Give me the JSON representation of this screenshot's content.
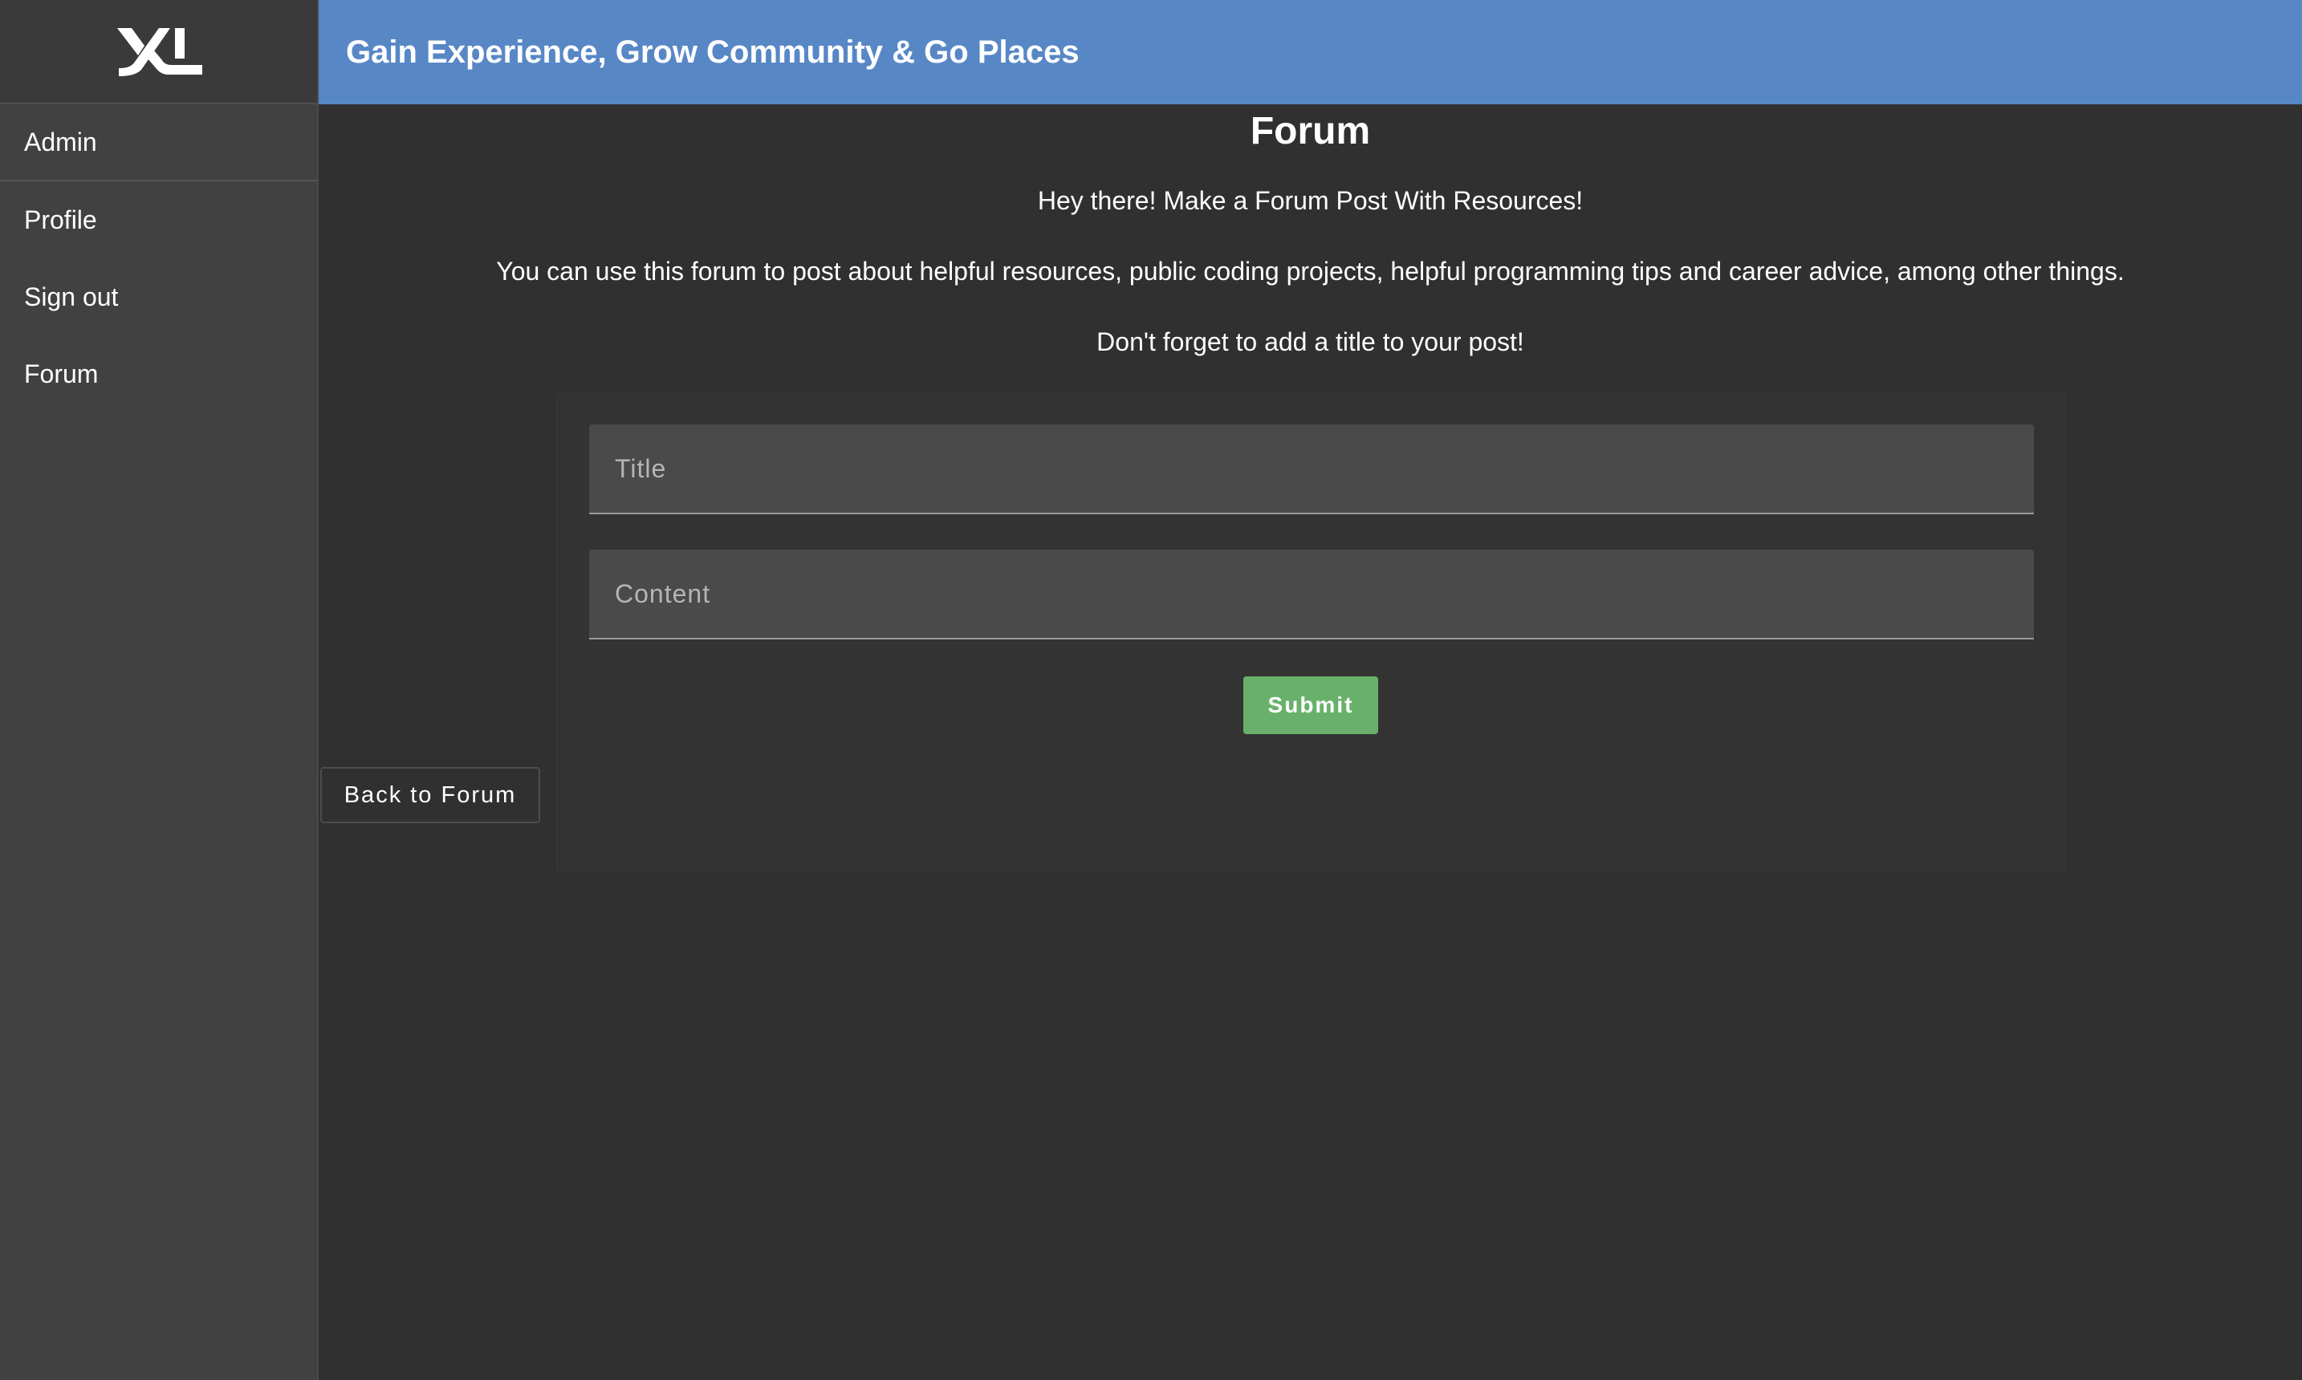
{
  "header": {
    "title": "Gain Experience, Grow Community & Go Places"
  },
  "sidebar": {
    "logo_icon": "xl-logo",
    "items": [
      {
        "label": "Admin"
      },
      {
        "label": "Profile"
      },
      {
        "label": "Sign out"
      },
      {
        "label": "Forum"
      }
    ]
  },
  "main": {
    "title": "Forum",
    "intro": [
      "Hey there! Make a Forum Post With Resources!",
      "You can use this forum to post about helpful resources, public coding projects, helpful programming tips and career advice, among other things.",
      "Don't forget to add a title to your post!"
    ],
    "form": {
      "title_placeholder": "Title",
      "title_value": "",
      "content_placeholder": "Content",
      "content_value": "",
      "submit_label": "Submit"
    },
    "back_label": "Back to Forum"
  },
  "colors": {
    "header_bg": "#5887c6",
    "sidebar_bg": "#414141",
    "main_bg": "#303030",
    "submit_bg": "#69b16b"
  }
}
